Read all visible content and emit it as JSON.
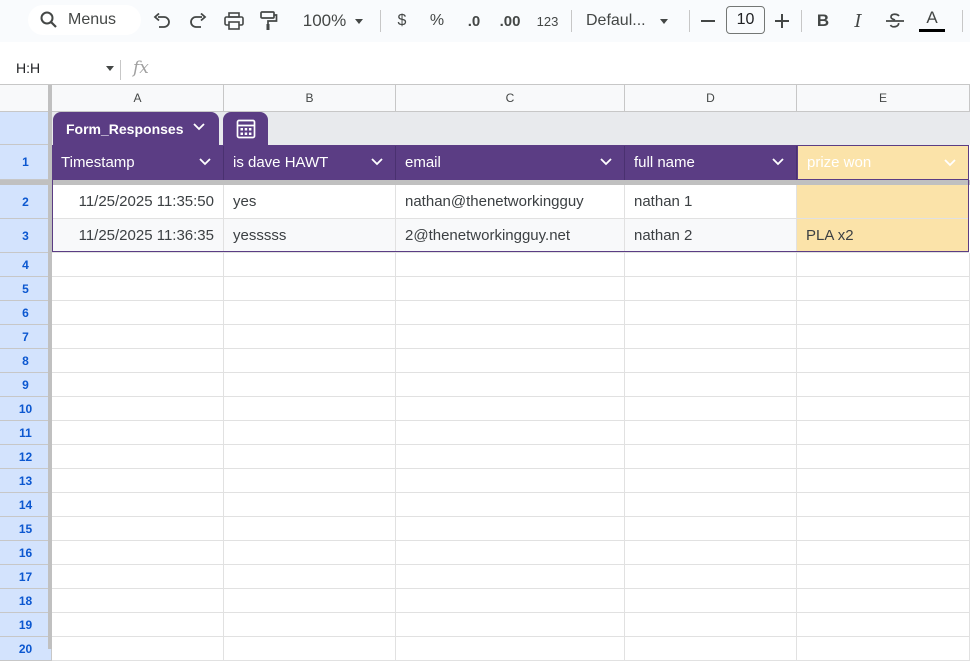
{
  "toolbar": {
    "search_label": "Menus",
    "zoom": "100%",
    "currency": "$",
    "percent": "%",
    "decrease_decimal": ".0",
    "increase_decimal": ".00",
    "number_format": "123",
    "font": "Defaul...",
    "font_size": "10",
    "bold": "B",
    "italic": "I",
    "text_color": "A"
  },
  "formula_bar": {
    "name_box": "H:H",
    "fx": "fx"
  },
  "columns": [
    "A",
    "B",
    "C",
    "D",
    "E"
  ],
  "rows": [
    "1",
    "2",
    "3",
    "4",
    "5",
    "6",
    "7",
    "8",
    "9",
    "10",
    "11",
    "12",
    "13",
    "14",
    "15",
    "16",
    "17",
    "18",
    "19",
    "20"
  ],
  "table": {
    "name": "Form_Responses",
    "headers": [
      "Timestamp",
      "is dave HAWT",
      "email",
      "full name",
      "prize won"
    ],
    "rows": [
      [
        "11/25/2025 11:35:50",
        "yes",
        "nathan@thenetworkingguy",
        "nathan 1",
        ""
      ],
      [
        "11/25/2025 11:36:35",
        "yesssss",
        "2@thenetworkingguy.net",
        "nathan 2",
        "PLA x2"
      ]
    ]
  },
  "colors": {
    "table_header": "#5b3d84",
    "prize_column": "#fbe3a9",
    "selected_header": "#d3e3fd"
  }
}
